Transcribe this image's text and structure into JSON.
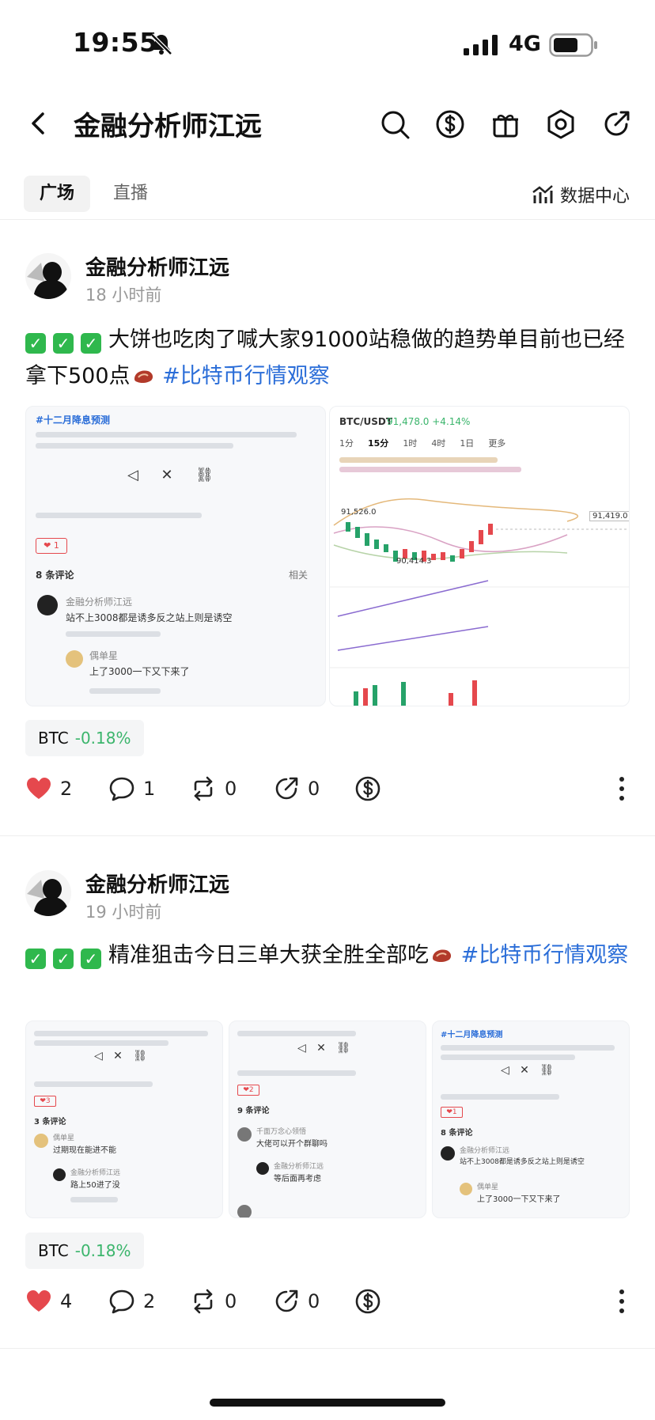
{
  "status_bar": {
    "time": "19:55",
    "network": "4G"
  },
  "header": {
    "title": "金融分析师江远"
  },
  "tabs": [
    {
      "label": "广场"
    },
    {
      "label": "直播"
    }
  ],
  "data_center_label": "数据中心",
  "posts": [
    {
      "author": "金融分析师江远",
      "time": "18 小时前",
      "text": "大饼也吃肉了喊大家91000站稳做的趋势单目前也已经拿下500点",
      "hashtag": "#比特币行情观察",
      "ticker": {
        "symbol": "BTC",
        "change": "-0.18%"
      },
      "likes": "2",
      "comments": "1",
      "reposts": "0",
      "shares": "0",
      "images": {
        "left_card": {
          "heading": "#十二月降息预测",
          "comment_count": "8 条评论",
          "sort": "相关",
          "comment1_author": "金融分析师江远",
          "comment1_text": "站不上3008都是诱多反之站上则是诱空",
          "comment2_author": "偶单星",
          "comment2_text": "上了3000一下又下来了"
        },
        "right_card": {
          "pair": "BTC/USDT",
          "price": "91,478.0 +4.14%",
          "intervals": [
            "1分",
            "15分",
            "1时",
            "4时",
            "1日",
            "更多"
          ],
          "high_label": "91,526.0",
          "low_label": "90,414.3",
          "last_price": "91,419.0"
        }
      }
    },
    {
      "author": "金融分析师江远",
      "time": "19 小时前",
      "text": "精准狙击今日三单大获全胜全部吃",
      "hashtag": "#比特币行情观察",
      "ticker": {
        "symbol": "BTC",
        "change": "-0.18%"
      },
      "likes": "4",
      "comments": "2",
      "reposts": "0",
      "shares": "0",
      "images": {
        "card1": {
          "comment_count": "3 条评论",
          "c1_author": "偶单星",
          "c1_text": "过期现在能进不能",
          "c2_author": "金融分析师江远",
          "c2_text": "路上50进了没"
        },
        "card2": {
          "comment_count": "9 条评论",
          "c1_author": "千面万念心领悟",
          "c1_text": "大佬可以开个群聊吗",
          "c2_author": "金融分析师江远",
          "c2_text": "等后面再考虑"
        },
        "card3": {
          "heading": "#十二月降息预测",
          "comment_count": "8 条评论",
          "c1_author": "金融分析师江远",
          "c1_text": "站不上3008都是诱多反之站上则是诱空",
          "c2_author": "偶单星",
          "c2_text": "上了3000一下又下来了"
        }
      }
    }
  ],
  "colors": {
    "link": "#2a6dd8",
    "positive_change": "#3bb56c",
    "like_heart": "#e5484d",
    "check_green": "#2fb84d"
  }
}
